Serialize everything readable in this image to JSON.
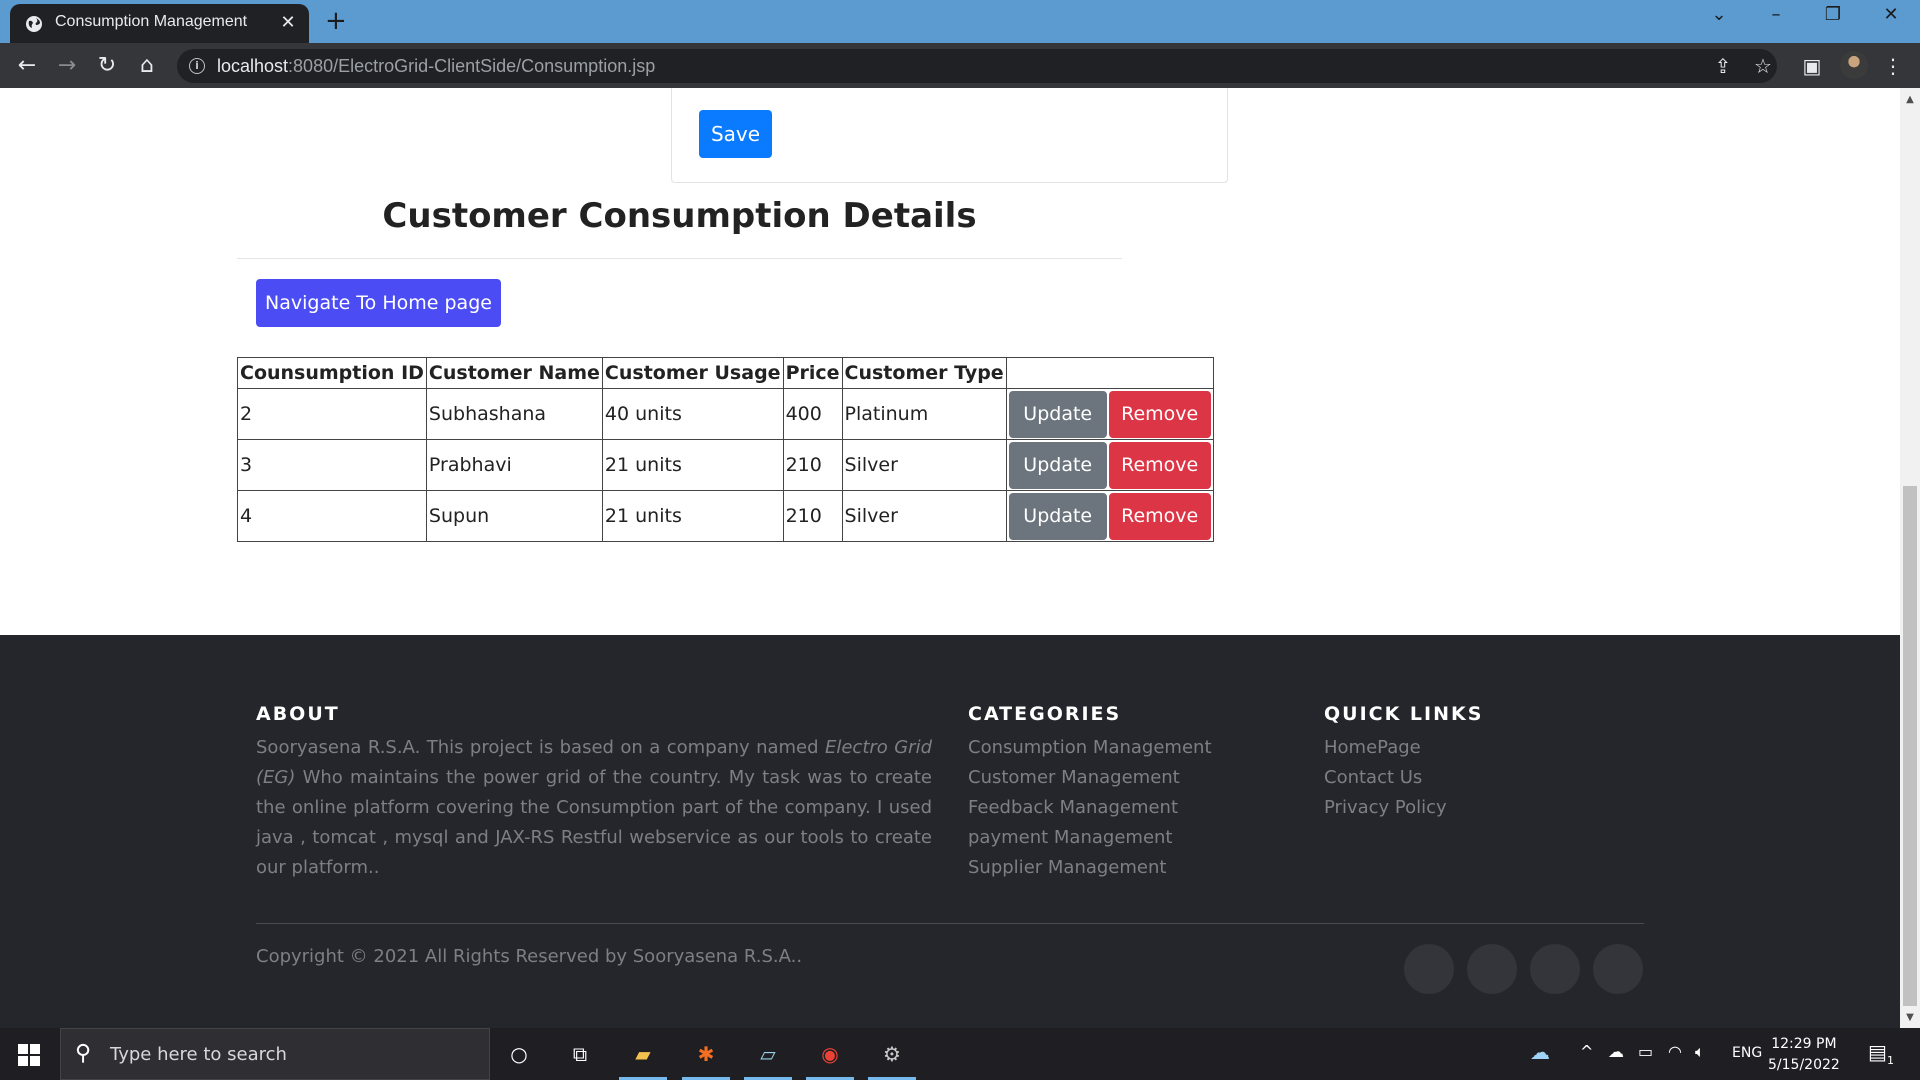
{
  "browser": {
    "tab_title": "Consumption Management",
    "url_host": "localhost",
    "url_rest": ":8080/ElectroGrid-ClientSide/Consumption.jsp"
  },
  "form": {
    "save_label": "Save"
  },
  "section": {
    "title": "Customer Consumption Details",
    "home_button": "Navigate To Home page"
  },
  "table": {
    "headers": [
      "Counsumption ID",
      "Customer Name",
      "Customer Usage",
      "Price",
      "Customer Type"
    ],
    "rows": [
      {
        "id": "2",
        "name": "Subhashana",
        "usage": "40 units",
        "price": "400",
        "type": "Platinum"
      },
      {
        "id": "3",
        "name": "Prabhavi",
        "usage": "21 units",
        "price": "210",
        "type": "Silver"
      },
      {
        "id": "4",
        "name": "Supun",
        "usage": "21 units",
        "price": "210",
        "type": "Silver"
      }
    ],
    "update_label": "Update",
    "remove_label": "Remove"
  },
  "footer": {
    "about_heading": "ABOUT",
    "about_text_1": "Sooryasena R.S.A. This project is based on a company named ",
    "about_text_em": "Electro Grid (EG)",
    "about_text_2": " Who maintains the power grid of the country. My task was to create the online platform covering the Consumption part of the company. I used java , tomcat , mysql and JAX-RS Restful webservice as our tools to create our platform..",
    "categories_heading": "CATEGORIES",
    "categories": [
      "Consumption Management",
      "Customer Management",
      "Feedback Management",
      "payment Management",
      "Supplier Management"
    ],
    "quicklinks_heading": "QUICK LINKS",
    "quicklinks": [
      "HomePage",
      "Contact Us",
      "Privacy Policy"
    ],
    "copyright": "Copyright © 2021 All Rights Reserved by Sooryasena R.S.A.."
  },
  "taskbar": {
    "search_placeholder": "Type here to search",
    "language": "ENG",
    "time": "12:29 PM",
    "date": "5/15/2022",
    "notification_count": "1"
  }
}
